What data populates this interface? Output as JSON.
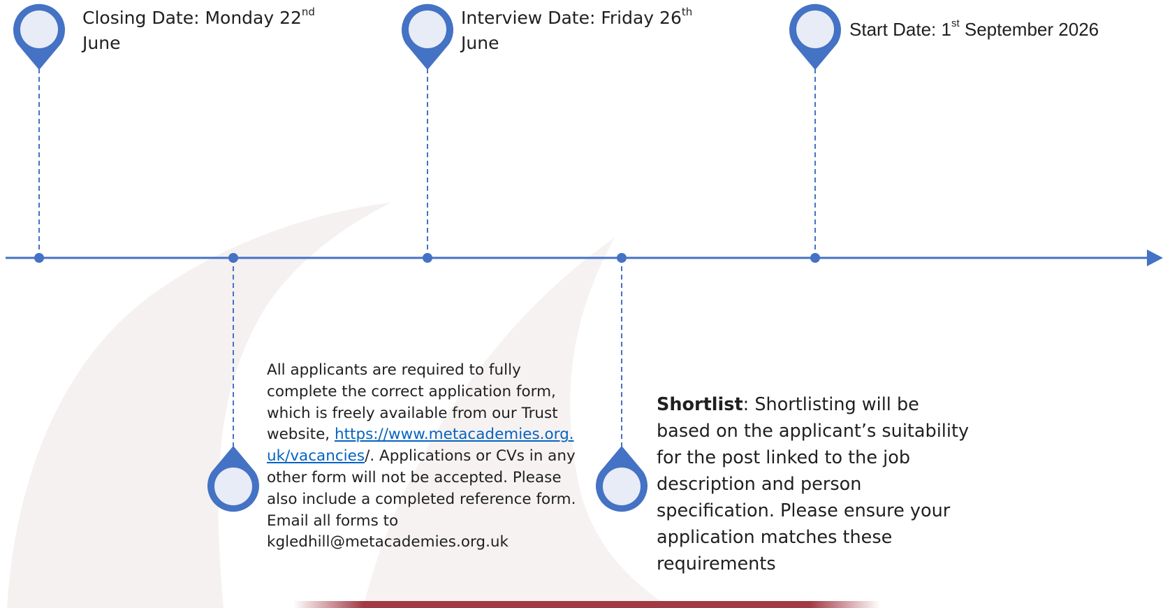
{
  "milestones": {
    "closing": {
      "prefix": "Closing Date: Monday 22",
      "sup": "nd",
      "suffix": "June"
    },
    "interview": {
      "prefix": "Interview Date: Friday 26",
      "sup": "th",
      "suffix": "June"
    },
    "start": {
      "prefix": "Start Date: 1",
      "sup": "st",
      "suffix": " September 2026"
    }
  },
  "application": {
    "text_before_link": "All applicants are required to fully complete the correct application form, which is freely available from our Trust website, ",
    "link_text": "https://www.metacademies.org.uk/vacancies",
    "text_after_link": "/. Applications or CVs in any other form will not be accepted.  Please also include a completed reference form. Email all forms to kgledhill@metacademies.org.uk"
  },
  "shortlist": {
    "heading": "Shortlist",
    "body": ": Shortlisting will be based on the applicant’s suitability for the post linked to the job description and person specification. Please ensure your application matches these requirements"
  },
  "colors": {
    "accent": "#4472c4",
    "pin_fill": "#e8ecf6",
    "link": "#0563c1",
    "footer_bar": "#a13a44"
  }
}
